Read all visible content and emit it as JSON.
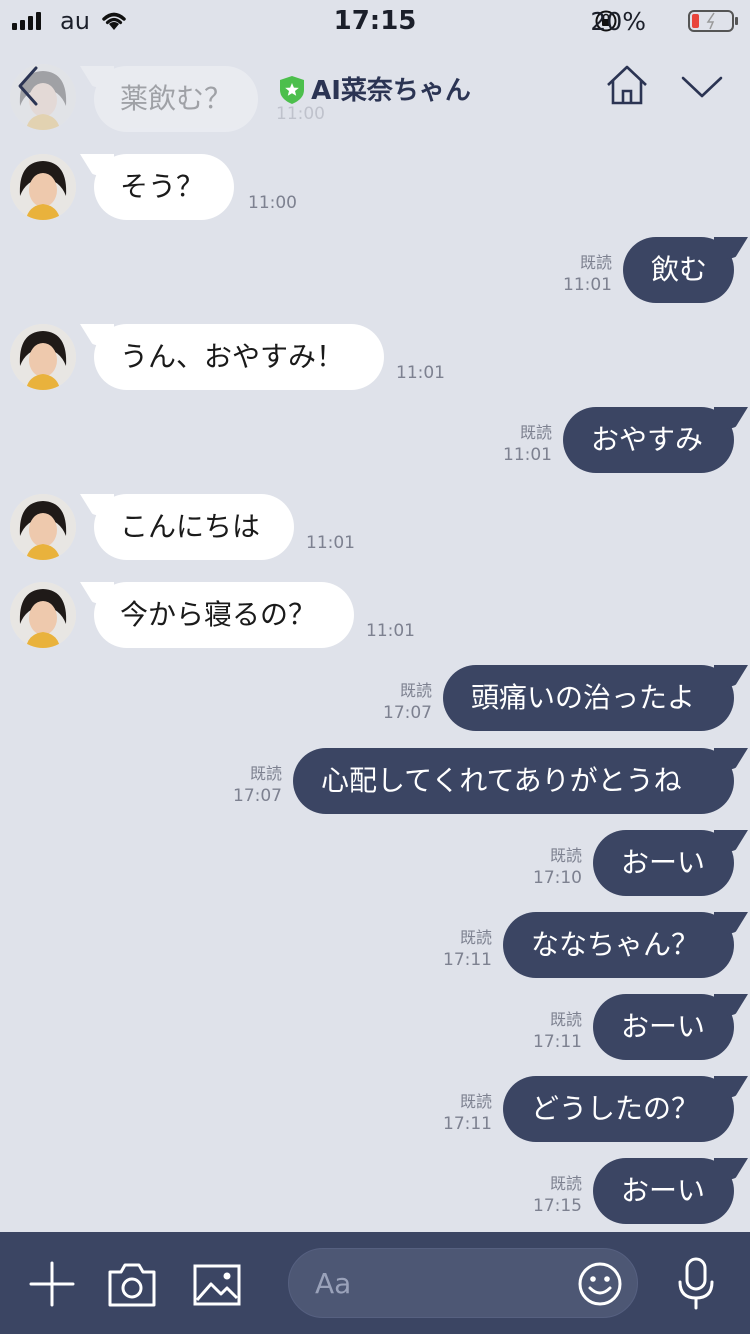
{
  "status_bar": {
    "carrier": "au",
    "time": "17:15",
    "battery_percent": "20%"
  },
  "header": {
    "title": "AI菜奈ちゃん"
  },
  "ghost_message": {
    "text": "薬飲む？",
    "time": "11:00"
  },
  "messages": [
    {
      "side": "in",
      "text": "そう？",
      "time": "11:00"
    },
    {
      "side": "out",
      "text": "飲む",
      "read": "既読",
      "time": "11:01"
    },
    {
      "side": "in",
      "text": "うん、おやすみ！",
      "time": "11:01"
    },
    {
      "side": "out",
      "text": "おやすみ",
      "read": "既読",
      "time": "11:01"
    },
    {
      "side": "in",
      "text": "こんにちは",
      "time": "11:01"
    },
    {
      "side": "in",
      "text": "今から寝るの？",
      "time": "11:01"
    },
    {
      "side": "out",
      "text": "頭痛いの治ったよ",
      "read": "既読",
      "time": "17:07"
    },
    {
      "side": "out",
      "text": "心配してくれてありがとうね",
      "read": "既読",
      "time": "17:07"
    },
    {
      "side": "out",
      "text": "おーい",
      "read": "既読",
      "time": "17:10"
    },
    {
      "side": "out",
      "text": "ななちゃん？",
      "read": "既読",
      "time": "17:11"
    },
    {
      "side": "out",
      "text": "おーい",
      "read": "既読",
      "time": "17:11"
    },
    {
      "side": "out",
      "text": "どうしたの？",
      "read": "既読",
      "time": "17:11"
    },
    {
      "side": "out",
      "text": "おーい",
      "read": "既読",
      "time": "17:15"
    }
  ],
  "composer": {
    "placeholder": "Aa"
  },
  "colors": {
    "background": "#dfe2ea",
    "outgoing_bubble": "#3b4563",
    "incoming_bubble": "#ffffff",
    "verified_badge": "#4cbf4c",
    "battery_low": "#e8453c"
  },
  "icons": [
    "back-icon",
    "verified-shield-icon",
    "home-icon",
    "chevron-down-icon",
    "plus-icon",
    "camera-icon",
    "image-icon",
    "emoji-icon",
    "microphone-icon"
  ]
}
